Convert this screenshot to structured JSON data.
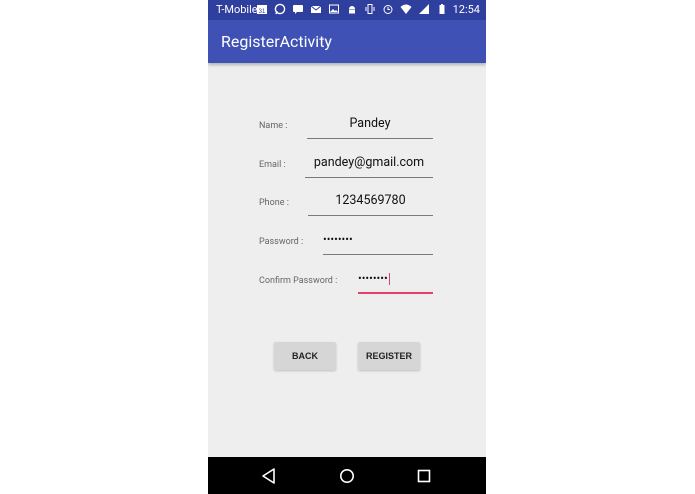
{
  "status_bar": {
    "carrier": "T-Mobile",
    "calendar_day": "31",
    "time": "12:54",
    "icons": [
      "calendar-icon",
      "whatsapp-icon",
      "chat-icon",
      "mail-icon",
      "image-icon",
      "android-icon",
      "vibrate-icon",
      "alarm-icon",
      "wifi-icon",
      "signal-icon",
      "battery-icon"
    ]
  },
  "app_bar": {
    "title": "RegisterActivity"
  },
  "form": {
    "name_label": "Name :",
    "name_value": "Pandey",
    "email_label": "Email :",
    "email_value": "pandey@gmail.com",
    "phone_label": "Phone :",
    "phone_value": "1234569780",
    "password_label": "Password :",
    "password_value": "••••••••",
    "confirm_label": "Confirm Password :",
    "confirm_value": "••••••••"
  },
  "buttons": {
    "back": "BACK",
    "register": "REGISTER"
  },
  "colors": {
    "primary": "#3f51b5",
    "primary_dark": "#2f3f9e",
    "accent": "#e83e6c",
    "background": "#eeeeee"
  },
  "nav_bar": {
    "icons": [
      "back-triangle-icon",
      "home-circle-icon",
      "recents-square-icon"
    ]
  }
}
